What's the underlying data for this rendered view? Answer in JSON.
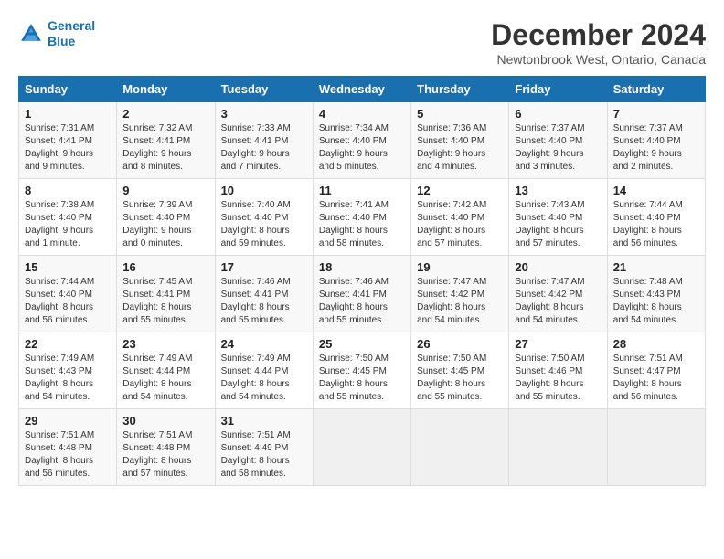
{
  "logo": {
    "line1": "General",
    "line2": "Blue"
  },
  "title": "December 2024",
  "subtitle": "Newtonbrook West, Ontario, Canada",
  "weekdays": [
    "Sunday",
    "Monday",
    "Tuesday",
    "Wednesday",
    "Thursday",
    "Friday",
    "Saturday"
  ],
  "days": [
    {
      "num": "",
      "sunrise": "",
      "sunset": "",
      "daylight": ""
    },
    {
      "num": "",
      "sunrise": "",
      "sunset": "",
      "daylight": ""
    },
    {
      "num": "",
      "sunrise": "",
      "sunset": "",
      "daylight": ""
    },
    {
      "num": "",
      "sunrise": "",
      "sunset": "",
      "daylight": ""
    },
    {
      "num": "",
      "sunrise": "",
      "sunset": "",
      "daylight": ""
    },
    {
      "num": "",
      "sunrise": "",
      "sunset": "",
      "daylight": ""
    },
    {
      "num": "7",
      "sunrise": "Sunrise: 7:37 AM",
      "sunset": "Sunset: 4:40 PM",
      "daylight": "Daylight: 9 hours and 2 minutes."
    },
    {
      "num": "1",
      "sunrise": "Sunrise: 7:31 AM",
      "sunset": "Sunset: 4:41 PM",
      "daylight": "Daylight: 9 hours and 9 minutes."
    },
    {
      "num": "2",
      "sunrise": "Sunrise: 7:32 AM",
      "sunset": "Sunset: 4:41 PM",
      "daylight": "Daylight: 9 hours and 8 minutes."
    },
    {
      "num": "3",
      "sunrise": "Sunrise: 7:33 AM",
      "sunset": "Sunset: 4:41 PM",
      "daylight": "Daylight: 9 hours and 7 minutes."
    },
    {
      "num": "4",
      "sunrise": "Sunrise: 7:34 AM",
      "sunset": "Sunset: 4:40 PM",
      "daylight": "Daylight: 9 hours and 5 minutes."
    },
    {
      "num": "5",
      "sunrise": "Sunrise: 7:36 AM",
      "sunset": "Sunset: 4:40 PM",
      "daylight": "Daylight: 9 hours and 4 minutes."
    },
    {
      "num": "6",
      "sunrise": "Sunrise: 7:37 AM",
      "sunset": "Sunset: 4:40 PM",
      "daylight": "Daylight: 9 hours and 3 minutes."
    },
    {
      "num": "7",
      "sunrise": "Sunrise: 7:37 AM",
      "sunset": "Sunset: 4:40 PM",
      "daylight": "Daylight: 9 hours and 2 minutes."
    },
    {
      "num": "8",
      "sunrise": "Sunrise: 7:38 AM",
      "sunset": "Sunset: 4:40 PM",
      "daylight": "Daylight: 9 hours and 1 minute."
    },
    {
      "num": "9",
      "sunrise": "Sunrise: 7:39 AM",
      "sunset": "Sunset: 4:40 PM",
      "daylight": "Daylight: 9 hours and 0 minutes."
    },
    {
      "num": "10",
      "sunrise": "Sunrise: 7:40 AM",
      "sunset": "Sunset: 4:40 PM",
      "daylight": "Daylight: 8 hours and 59 minutes."
    },
    {
      "num": "11",
      "sunrise": "Sunrise: 7:41 AM",
      "sunset": "Sunset: 4:40 PM",
      "daylight": "Daylight: 8 hours and 58 minutes."
    },
    {
      "num": "12",
      "sunrise": "Sunrise: 7:42 AM",
      "sunset": "Sunset: 4:40 PM",
      "daylight": "Daylight: 8 hours and 57 minutes."
    },
    {
      "num": "13",
      "sunrise": "Sunrise: 7:43 AM",
      "sunset": "Sunset: 4:40 PM",
      "daylight": "Daylight: 8 hours and 57 minutes."
    },
    {
      "num": "14",
      "sunrise": "Sunrise: 7:44 AM",
      "sunset": "Sunset: 4:40 PM",
      "daylight": "Daylight: 8 hours and 56 minutes."
    },
    {
      "num": "15",
      "sunrise": "Sunrise: 7:44 AM",
      "sunset": "Sunset: 4:40 PM",
      "daylight": "Daylight: 8 hours and 56 minutes."
    },
    {
      "num": "16",
      "sunrise": "Sunrise: 7:45 AM",
      "sunset": "Sunset: 4:41 PM",
      "daylight": "Daylight: 8 hours and 55 minutes."
    },
    {
      "num": "17",
      "sunrise": "Sunrise: 7:46 AM",
      "sunset": "Sunset: 4:41 PM",
      "daylight": "Daylight: 8 hours and 55 minutes."
    },
    {
      "num": "18",
      "sunrise": "Sunrise: 7:46 AM",
      "sunset": "Sunset: 4:41 PM",
      "daylight": "Daylight: 8 hours and 55 minutes."
    },
    {
      "num": "19",
      "sunrise": "Sunrise: 7:47 AM",
      "sunset": "Sunset: 4:42 PM",
      "daylight": "Daylight: 8 hours and 54 minutes."
    },
    {
      "num": "20",
      "sunrise": "Sunrise: 7:47 AM",
      "sunset": "Sunset: 4:42 PM",
      "daylight": "Daylight: 8 hours and 54 minutes."
    },
    {
      "num": "21",
      "sunrise": "Sunrise: 7:48 AM",
      "sunset": "Sunset: 4:43 PM",
      "daylight": "Daylight: 8 hours and 54 minutes."
    },
    {
      "num": "22",
      "sunrise": "Sunrise: 7:49 AM",
      "sunset": "Sunset: 4:43 PM",
      "daylight": "Daylight: 8 hours and 54 minutes."
    },
    {
      "num": "23",
      "sunrise": "Sunrise: 7:49 AM",
      "sunset": "Sunset: 4:44 PM",
      "daylight": "Daylight: 8 hours and 54 minutes."
    },
    {
      "num": "24",
      "sunrise": "Sunrise: 7:49 AM",
      "sunset": "Sunset: 4:44 PM",
      "daylight": "Daylight: 8 hours and 54 minutes."
    },
    {
      "num": "25",
      "sunrise": "Sunrise: 7:50 AM",
      "sunset": "Sunset: 4:45 PM",
      "daylight": "Daylight: 8 hours and 55 minutes."
    },
    {
      "num": "26",
      "sunrise": "Sunrise: 7:50 AM",
      "sunset": "Sunset: 4:45 PM",
      "daylight": "Daylight: 8 hours and 55 minutes."
    },
    {
      "num": "27",
      "sunrise": "Sunrise: 7:50 AM",
      "sunset": "Sunset: 4:46 PM",
      "daylight": "Daylight: 8 hours and 55 minutes."
    },
    {
      "num": "28",
      "sunrise": "Sunrise: 7:51 AM",
      "sunset": "Sunset: 4:47 PM",
      "daylight": "Daylight: 8 hours and 56 minutes."
    },
    {
      "num": "29",
      "sunrise": "Sunrise: 7:51 AM",
      "sunset": "Sunset: 4:48 PM",
      "daylight": "Daylight: 8 hours and 56 minutes."
    },
    {
      "num": "30",
      "sunrise": "Sunrise: 7:51 AM",
      "sunset": "Sunset: 4:48 PM",
      "daylight": "Daylight: 8 hours and 57 minutes."
    },
    {
      "num": "31",
      "sunrise": "Sunrise: 7:51 AM",
      "sunset": "Sunset: 4:49 PM",
      "daylight": "Daylight: 8 hours and 58 minutes."
    }
  ],
  "rows": [
    {
      "cells": [
        {
          "num": "1",
          "sunrise": "Sunrise: 7:31 AM",
          "sunset": "Sunset: 4:41 PM",
          "daylight": "Daylight: 9 hours and 9 minutes."
        },
        {
          "num": "2",
          "sunrise": "Sunrise: 7:32 AM",
          "sunset": "Sunset: 4:41 PM",
          "daylight": "Daylight: 9 hours and 8 minutes."
        },
        {
          "num": "3",
          "sunrise": "Sunrise: 7:33 AM",
          "sunset": "Sunset: 4:41 PM",
          "daylight": "Daylight: 9 hours and 7 minutes."
        },
        {
          "num": "4",
          "sunrise": "Sunrise: 7:34 AM",
          "sunset": "Sunset: 4:40 PM",
          "daylight": "Daylight: 9 hours and 5 minutes."
        },
        {
          "num": "5",
          "sunrise": "Sunrise: 7:36 AM",
          "sunset": "Sunset: 4:40 PM",
          "daylight": "Daylight: 9 hours and 4 minutes."
        },
        {
          "num": "6",
          "sunrise": "Sunrise: 7:37 AM",
          "sunset": "Sunset: 4:40 PM",
          "daylight": "Daylight: 9 hours and 3 minutes."
        },
        {
          "num": "7",
          "sunrise": "Sunrise: 7:37 AM",
          "sunset": "Sunset: 4:40 PM",
          "daylight": "Daylight: 9 hours and 2 minutes."
        }
      ]
    },
    {
      "cells": [
        {
          "num": "8",
          "sunrise": "Sunrise: 7:38 AM",
          "sunset": "Sunset: 4:40 PM",
          "daylight": "Daylight: 9 hours and 1 minute."
        },
        {
          "num": "9",
          "sunrise": "Sunrise: 7:39 AM",
          "sunset": "Sunset: 4:40 PM",
          "daylight": "Daylight: 9 hours and 0 minutes."
        },
        {
          "num": "10",
          "sunrise": "Sunrise: 7:40 AM",
          "sunset": "Sunset: 4:40 PM",
          "daylight": "Daylight: 8 hours and 59 minutes."
        },
        {
          "num": "11",
          "sunrise": "Sunrise: 7:41 AM",
          "sunset": "Sunset: 4:40 PM",
          "daylight": "Daylight: 8 hours and 58 minutes."
        },
        {
          "num": "12",
          "sunrise": "Sunrise: 7:42 AM",
          "sunset": "Sunset: 4:40 PM",
          "daylight": "Daylight: 8 hours and 57 minutes."
        },
        {
          "num": "13",
          "sunrise": "Sunrise: 7:43 AM",
          "sunset": "Sunset: 4:40 PM",
          "daylight": "Daylight: 8 hours and 57 minutes."
        },
        {
          "num": "14",
          "sunrise": "Sunrise: 7:44 AM",
          "sunset": "Sunset: 4:40 PM",
          "daylight": "Daylight: 8 hours and 56 minutes."
        }
      ]
    },
    {
      "cells": [
        {
          "num": "15",
          "sunrise": "Sunrise: 7:44 AM",
          "sunset": "Sunset: 4:40 PM",
          "daylight": "Daylight: 8 hours and 56 minutes."
        },
        {
          "num": "16",
          "sunrise": "Sunrise: 7:45 AM",
          "sunset": "Sunset: 4:41 PM",
          "daylight": "Daylight: 8 hours and 55 minutes."
        },
        {
          "num": "17",
          "sunrise": "Sunrise: 7:46 AM",
          "sunset": "Sunset: 4:41 PM",
          "daylight": "Daylight: 8 hours and 55 minutes."
        },
        {
          "num": "18",
          "sunrise": "Sunrise: 7:46 AM",
          "sunset": "Sunset: 4:41 PM",
          "daylight": "Daylight: 8 hours and 55 minutes."
        },
        {
          "num": "19",
          "sunrise": "Sunrise: 7:47 AM",
          "sunset": "Sunset: 4:42 PM",
          "daylight": "Daylight: 8 hours and 54 minutes."
        },
        {
          "num": "20",
          "sunrise": "Sunrise: 7:47 AM",
          "sunset": "Sunset: 4:42 PM",
          "daylight": "Daylight: 8 hours and 54 minutes."
        },
        {
          "num": "21",
          "sunrise": "Sunrise: 7:48 AM",
          "sunset": "Sunset: 4:43 PM",
          "daylight": "Daylight: 8 hours and 54 minutes."
        }
      ]
    },
    {
      "cells": [
        {
          "num": "22",
          "sunrise": "Sunrise: 7:49 AM",
          "sunset": "Sunset: 4:43 PM",
          "daylight": "Daylight: 8 hours and 54 minutes."
        },
        {
          "num": "23",
          "sunrise": "Sunrise: 7:49 AM",
          "sunset": "Sunset: 4:44 PM",
          "daylight": "Daylight: 8 hours and 54 minutes."
        },
        {
          "num": "24",
          "sunrise": "Sunrise: 7:49 AM",
          "sunset": "Sunset: 4:44 PM",
          "daylight": "Daylight: 8 hours and 54 minutes."
        },
        {
          "num": "25",
          "sunrise": "Sunrise: 7:50 AM",
          "sunset": "Sunset: 4:45 PM",
          "daylight": "Daylight: 8 hours and 55 minutes."
        },
        {
          "num": "26",
          "sunrise": "Sunrise: 7:50 AM",
          "sunset": "Sunset: 4:45 PM",
          "daylight": "Daylight: 8 hours and 55 minutes."
        },
        {
          "num": "27",
          "sunrise": "Sunrise: 7:50 AM",
          "sunset": "Sunset: 4:46 PM",
          "daylight": "Daylight: 8 hours and 55 minutes."
        },
        {
          "num": "28",
          "sunrise": "Sunrise: 7:51 AM",
          "sunset": "Sunset: 4:47 PM",
          "daylight": "Daylight: 8 hours and 56 minutes."
        }
      ]
    },
    {
      "cells": [
        {
          "num": "29",
          "sunrise": "Sunrise: 7:51 AM",
          "sunset": "Sunset: 4:48 PM",
          "daylight": "Daylight: 8 hours and 56 minutes."
        },
        {
          "num": "30",
          "sunrise": "Sunrise: 7:51 AM",
          "sunset": "Sunset: 4:48 PM",
          "daylight": "Daylight: 8 hours and 57 minutes."
        },
        {
          "num": "31",
          "sunrise": "Sunrise: 7:51 AM",
          "sunset": "Sunset: 4:49 PM",
          "daylight": "Daylight: 8 hours and 58 minutes."
        },
        {
          "num": "",
          "sunrise": "",
          "sunset": "",
          "daylight": ""
        },
        {
          "num": "",
          "sunrise": "",
          "sunset": "",
          "daylight": ""
        },
        {
          "num": "",
          "sunrise": "",
          "sunset": "",
          "daylight": ""
        },
        {
          "num": "",
          "sunrise": "",
          "sunset": "",
          "daylight": ""
        }
      ]
    }
  ]
}
